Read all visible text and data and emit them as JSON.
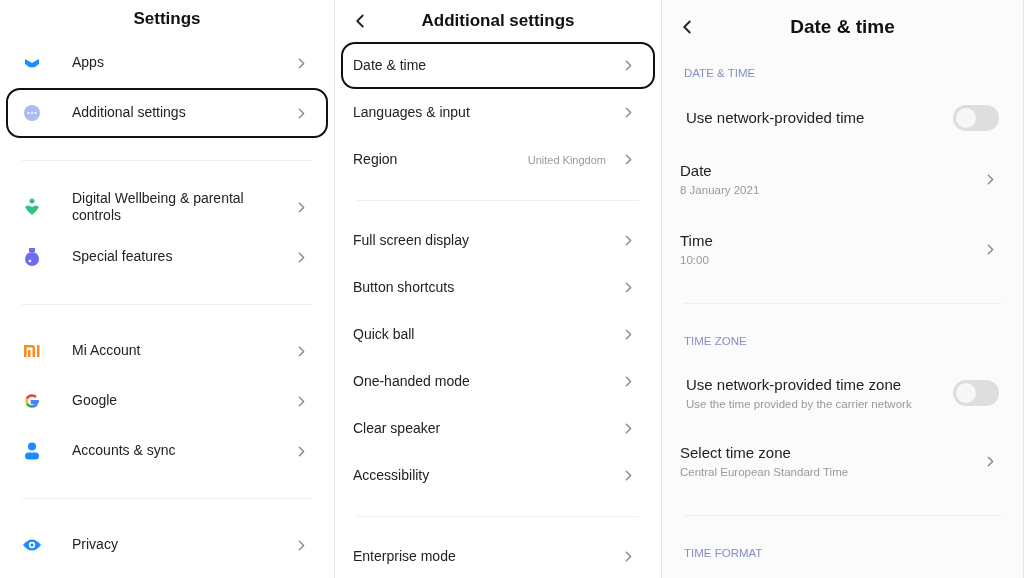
{
  "panels": [
    {
      "title": "Settings",
      "items": [
        {
          "kind": "row",
          "label": "Apps",
          "selected": false
        },
        {
          "kind": "row",
          "label": "Additional settings",
          "selected": true
        },
        {
          "kind": "divider"
        },
        {
          "kind": "row",
          "label": "Digital Wellbeing & parental controls",
          "selected": false
        },
        {
          "kind": "row",
          "label": "Special features",
          "selected": false
        },
        {
          "kind": "divider"
        },
        {
          "kind": "row",
          "label": "Mi Account",
          "selected": false
        },
        {
          "kind": "row",
          "label": "Google",
          "selected": false
        },
        {
          "kind": "row",
          "label": "Accounts & sync",
          "selected": false
        },
        {
          "kind": "divider"
        },
        {
          "kind": "row",
          "label": "Privacy",
          "selected": false
        }
      ]
    },
    {
      "title": "Additional settings",
      "has_back": true,
      "items": [
        {
          "kind": "row",
          "label": "Date & time",
          "selected": true
        },
        {
          "kind": "row",
          "label": "Languages & input",
          "selected": false
        },
        {
          "kind": "row",
          "label": "Region",
          "value": "United Kingdom",
          "selected": false
        },
        {
          "kind": "divider"
        },
        {
          "kind": "row",
          "label": "Full screen display",
          "selected": false
        },
        {
          "kind": "row",
          "label": "Button shortcuts",
          "selected": false
        },
        {
          "kind": "row",
          "label": "Quick ball",
          "selected": false
        },
        {
          "kind": "row",
          "label": "One-handed mode",
          "selected": false
        },
        {
          "kind": "row",
          "label": "Clear speaker",
          "selected": false
        },
        {
          "kind": "row",
          "label": "Accessibility",
          "selected": false
        },
        {
          "kind": "divider"
        },
        {
          "kind": "row",
          "label": "Enterprise mode",
          "selected": false
        }
      ]
    },
    {
      "title": "Date & time",
      "has_back": true,
      "items": [
        {
          "kind": "section",
          "label": "DATE & TIME"
        },
        {
          "kind": "toggle",
          "label": "Use network-provided time",
          "on": false
        },
        {
          "kind": "row",
          "label": "Date",
          "subtitle": "8 January 2021",
          "selected": false
        },
        {
          "kind": "row",
          "label": "Time",
          "subtitle": "10:00",
          "selected": false
        },
        {
          "kind": "divider"
        },
        {
          "kind": "section",
          "label": "TIME ZONE"
        },
        {
          "kind": "toggle",
          "label": "Use network-provided time zone",
          "subtitle": "Use the time provided by the carrier network",
          "on": false
        },
        {
          "kind": "row",
          "label": "Select time zone",
          "subtitle": "Central European Standard Time",
          "selected": false
        },
        {
          "kind": "divider"
        },
        {
          "kind": "section",
          "label": "TIME FORMAT"
        }
      ]
    }
  ]
}
